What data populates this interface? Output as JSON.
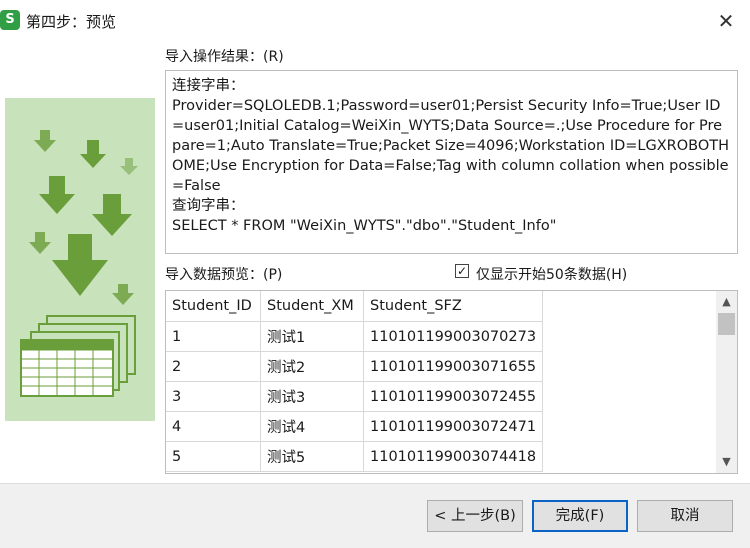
{
  "window": {
    "title": "第四步：预览",
    "app_icon_glyph": "S",
    "close_glyph": "✕"
  },
  "result": {
    "label": "导入操作结果：(R)",
    "text": "连接字串：\nProvider=SQLOLEDB.1;Password=user01;Persist Security Info=True;User ID=user01;Initial Catalog=WeiXin_WYTS;Data Source=.;Use Procedure for Prepare=1;Auto Translate=True;Packet Size=4096;Workstation ID=LGXROBOTHOME;Use Encryption for Data=False;Tag with column collation when possible=False\n查询字串：\nSELECT * FROM \"WeiXin_WYTS\".\"dbo\".\"Student_Info\""
  },
  "preview": {
    "label": "导入数据预览：(P)",
    "checkbox_label": "仅显示开始50条数据(H)",
    "checkbox_checked": true,
    "checkbox_glyph": "✓",
    "columns": [
      "Student_ID",
      "Student_XM",
      "Student_SFZ"
    ],
    "rows": [
      [
        "1",
        "测试1",
        "110101199003070273"
      ],
      [
        "2",
        "测试2",
        "110101199003071655"
      ],
      [
        "3",
        "测试3",
        "110101199003072455"
      ],
      [
        "4",
        "测试4",
        "110101199003072471"
      ],
      [
        "5",
        "测试5",
        "110101199003074418"
      ]
    ]
  },
  "buttons": {
    "back": "< 上一步(B)",
    "finish": "完成(F)",
    "cancel": "取消"
  },
  "colors": {
    "illustration_bg": "#c8e2bc",
    "icon_green": "#6a9e3a",
    "primary_border": "#0a64c8"
  }
}
